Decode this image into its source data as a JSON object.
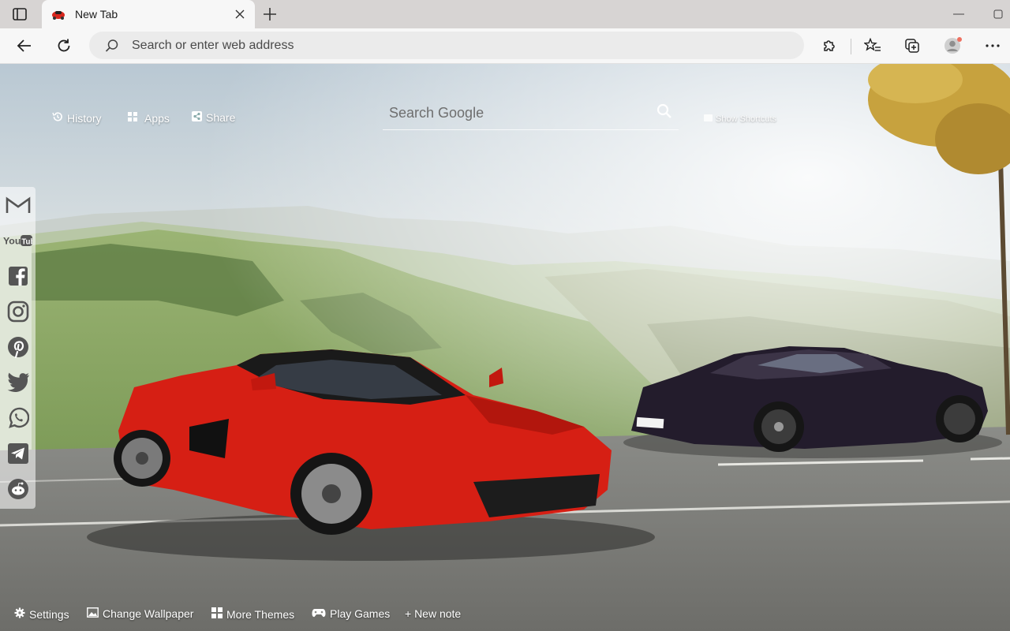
{
  "browser": {
    "tab": {
      "title": "New Tab",
      "favicon": "red-car-icon"
    },
    "address_placeholder": "Search or enter web address",
    "icons": {
      "tab_actions": "tab-actions-icon",
      "back": "back-arrow-icon",
      "refresh": "refresh-icon",
      "extensions": "puzzle-icon",
      "favorites": "star-list-icon",
      "collections": "collections-icon",
      "profile": "profile-icon",
      "more": "more-dots-icon"
    },
    "accent": "#ee7060"
  },
  "newtab": {
    "top_links": [
      {
        "label": "History",
        "icon": "history-icon"
      },
      {
        "label": "Apps",
        "icon": "apps-grid-icon"
      },
      {
        "label": "Share",
        "icon": "share-icon"
      }
    ],
    "search_placeholder": "Search Google",
    "show_shortcuts": "Show Shortcuts",
    "social": [
      "gmail",
      "youtube",
      "facebook",
      "instagram",
      "pinterest",
      "twitter",
      "whatsapp",
      "telegram",
      "reddit"
    ],
    "bottom_links": [
      {
        "label": "Settings",
        "icon": "gear-icon"
      },
      {
        "label": "Change Wallpaper",
        "icon": "wallpaper-icon"
      },
      {
        "label": "More Themes",
        "icon": "themes-grid-icon"
      },
      {
        "label": "Play Games",
        "icon": "gamepad-icon"
      },
      {
        "label": "+ New note",
        "icon": ""
      }
    ]
  }
}
